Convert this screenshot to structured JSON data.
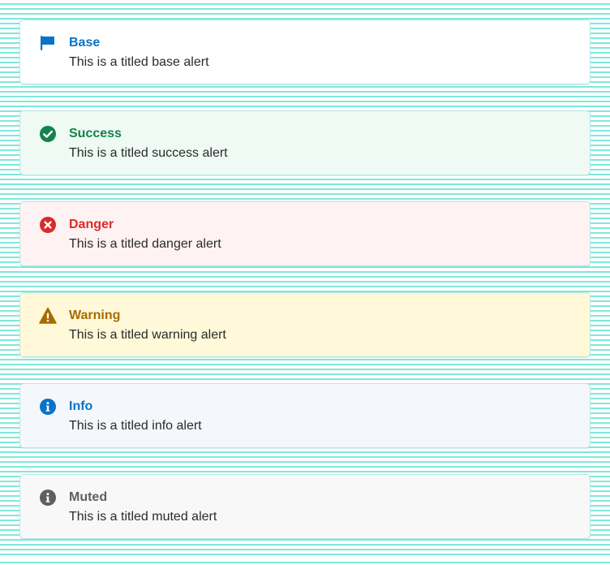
{
  "alerts": [
    {
      "title": "Base",
      "body": "This is a titled base alert",
      "icon": "flag-icon",
      "accent": "#0a73c9",
      "background": "#ffffff"
    },
    {
      "title": "Success",
      "body": "This is a titled success alert",
      "icon": "check-circle-icon",
      "accent": "#13834b",
      "background": "#eefaf3"
    },
    {
      "title": "Danger",
      "body": "This is a titled danger alert",
      "icon": "x-circle-icon",
      "accent": "#d92b2b",
      "background": "#fff2f2"
    },
    {
      "title": "Warning",
      "body": "This is a titled warning alert",
      "icon": "warning-triangle-icon",
      "accent": "#a86b00",
      "background": "#fff9d9"
    },
    {
      "title": "Info",
      "body": "This is a titled info alert",
      "icon": "info-circle-icon",
      "accent": "#0a73c9",
      "background": "#f4f7fb"
    },
    {
      "title": "Muted",
      "body": "This is a titled muted alert",
      "icon": "info-circle-icon",
      "accent": "#5f5f5f",
      "background": "#f8f8f8"
    }
  ]
}
